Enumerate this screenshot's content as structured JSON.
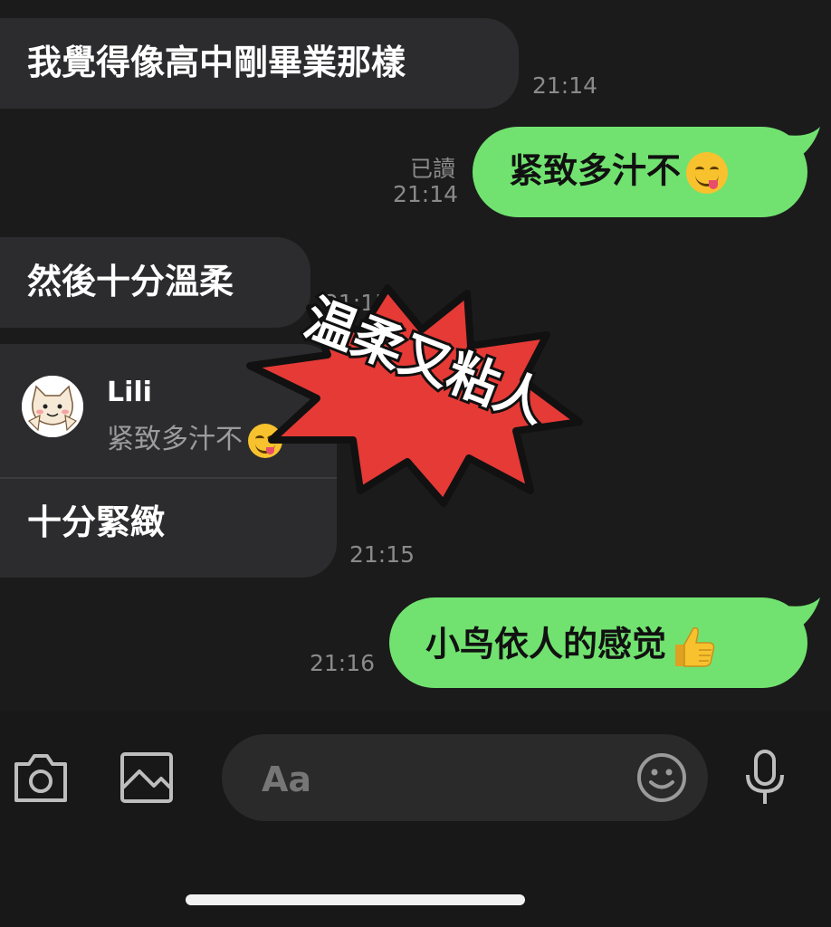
{
  "messages": [
    {
      "side": "in",
      "text": "我覺得像高中剛畢業那樣",
      "time": "21:14"
    },
    {
      "side": "out",
      "text": "紧致多汁不",
      "emoji": "yum-face",
      "read": "已讀",
      "time": "21:14"
    },
    {
      "side": "in",
      "text": "然後十分溫柔",
      "time": "21:15"
    },
    {
      "side": "in",
      "reply_to": {
        "name": "Lili",
        "quote": "紧致多汁不"
      },
      "text": "十分緊緻",
      "time": "21:15"
    },
    {
      "side": "out",
      "text": "小鸟依人的感觉",
      "emoji": "thumbs-up",
      "time": "21:16"
    }
  ],
  "sticker": {
    "text": "温柔又粘人",
    "color": "#e53a36"
  },
  "input": {
    "placeholder": "Aa"
  },
  "colors": {
    "out_bubble": "#71e270",
    "in_bubble": "#2c2c2e",
    "background": "#1b1b1b"
  }
}
